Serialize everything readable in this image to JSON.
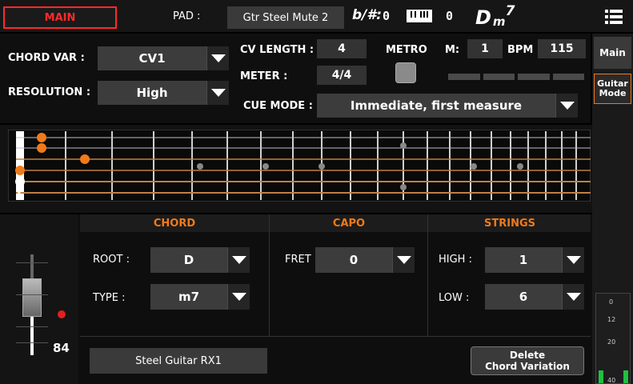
{
  "top_bar": {
    "main_tab": "MAIN",
    "pad_label": "PAD :",
    "pad_value": "Gtr Steel Mute 2",
    "accidental_label": "b/#:",
    "accidental_value": "0",
    "keyboard_value": "0",
    "chord_root": "D",
    "chord_quality": "m",
    "chord_ext": "7"
  },
  "controls": {
    "chord_var_label": "CHORD VAR :",
    "chord_var_value": "CV1",
    "resolution_label": "RESOLUTION :",
    "resolution_value": "High",
    "cv_length_label": "CV LENGTH :",
    "cv_length_value": "4",
    "meter_label": "METER :",
    "meter_value": "4/4",
    "metro_label": "METRO",
    "m_label": "M:",
    "m_value": "1",
    "bpm_label": "BPM :",
    "bpm_value": "115",
    "cue_mode_label": "CUE MODE :",
    "cue_mode_value": "Immediate, first measure"
  },
  "side_tabs": {
    "main": "Main",
    "guitar_mode": "Guitar Mode"
  },
  "fretboard": {
    "open_marker": "x"
  },
  "sections": {
    "chord_header": "CHORD",
    "capo_header": "CAPO",
    "strings_header": "STRINGS",
    "root_label": "ROOT :",
    "root_value": "D",
    "type_label": "TYPE :",
    "type_value": "m7",
    "fret_label": "FRET :",
    "fret_value": "0",
    "high_label": "HIGH :",
    "high_value": "1",
    "low_label": "LOW :",
    "low_value": "6"
  },
  "bottom": {
    "volume_value": "84",
    "volume_level": 0.62,
    "sound_name": "Steel Guitar RX1",
    "delete_label_1": "Delete",
    "delete_label_2": "Chord Variation"
  },
  "meter_scale": [
    "0",
    "12",
    "20",
    "40"
  ],
  "colors": {
    "accent_orange": "#f07a1a",
    "main_tab_red": "#ff2a2a",
    "fret_wire": "#d0d0d0",
    "string": "#e0e0e0"
  }
}
